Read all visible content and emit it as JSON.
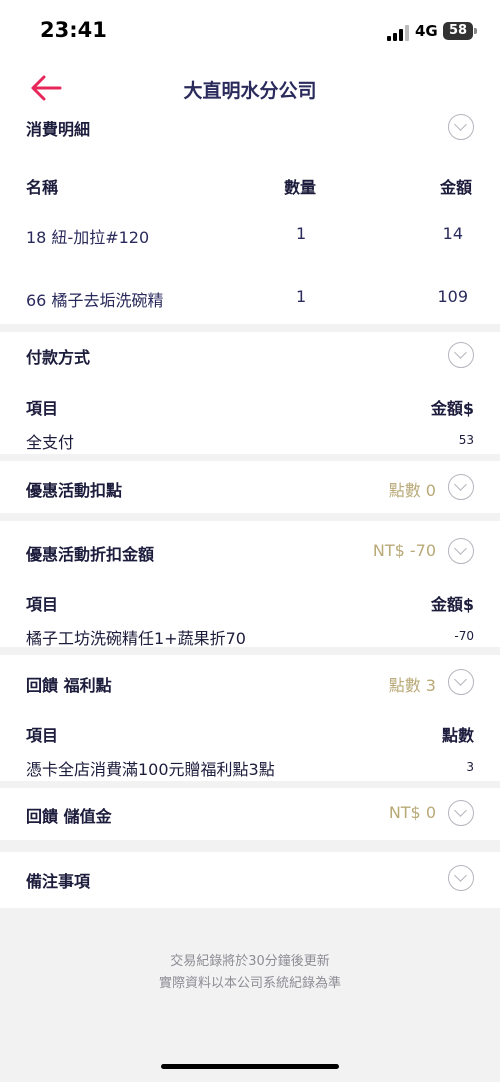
{
  "status_bar": {
    "time": "23:41",
    "network": "4G",
    "battery": "58"
  },
  "nav": {
    "title": "大直明水分公司"
  },
  "consumption": {
    "header": "消費明細",
    "columns": [
      "名稱",
      "數量",
      "金額"
    ],
    "rows": [
      {
        "name": "18 紐-加拉#120",
        "qty": "1",
        "amount": "14"
      },
      {
        "name": "66 橘子去垢洗碗精",
        "qty": "1",
        "amount": "109"
      }
    ]
  },
  "payment": {
    "header": "付款方式",
    "col_item": "項目",
    "col_amount": "金額$",
    "row_label": "全支付",
    "row_value": "53"
  },
  "promo_points": {
    "header": "優惠活動扣點",
    "value": "點數 0"
  },
  "promo_discount": {
    "header": "優惠活動折扣金額",
    "value": "NT$ -70",
    "col_item": "項目",
    "col_amount": "金額$",
    "row_label": "橘子工坊洗碗精任1+蔬果折70",
    "row_value": "-70"
  },
  "reward_points": {
    "header": "回饋 福利點",
    "value": "點數 3",
    "col_item": "項目",
    "col_points": "點數",
    "row_label": "憑卡全店消費滿100元贈福利點3點",
    "row_value": "3"
  },
  "reward_stored": {
    "header": "回饋 儲值金",
    "value": "NT$ 0"
  },
  "notes": {
    "header": "備注事項"
  },
  "footer": {
    "line1": "交易紀錄將於30分鐘後更新",
    "line2": "實際資料以本公司系統紀錄為準"
  },
  "colors": {
    "accent": "#e8265a",
    "title": "#2a2a5c",
    "muted_gold": "#b9a977"
  }
}
